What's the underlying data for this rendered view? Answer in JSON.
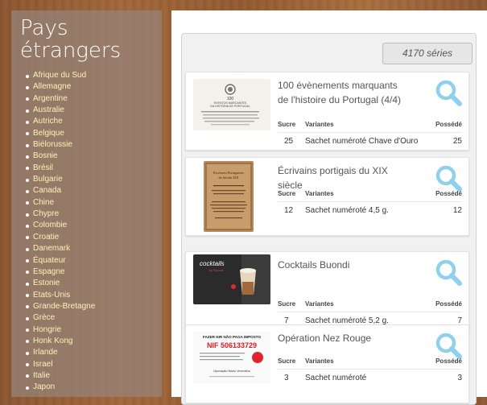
{
  "sidebar": {
    "title_line1": "Pays",
    "title_line2": "étrangers",
    "countries": [
      "Afrique du Sud",
      "Allemagne",
      "Argentine",
      "Australie",
      "Autriche",
      "Belgique",
      "Biélorussie",
      "Bosnie",
      "Brésil",
      "Bulgarie",
      "Canada",
      "Chine",
      "Chypre",
      "Colombie",
      "Croatie",
      "Danemark",
      "Équateur",
      "Espagne",
      "Estonie",
      "Etats-Unis",
      "Grande-Bretagne",
      "Grèce",
      "Hongrie",
      "Honk Kong",
      "Irlande",
      "Israel",
      "Italie",
      "Japon"
    ]
  },
  "main": {
    "series_count": "4170 séries",
    "columns": {
      "sucre": "Sucre",
      "variantes": "Variantes",
      "possede": "Possédé"
    },
    "cards": [
      {
        "title": "100 évènements marquants de l'histoire du Portugal (4/4)",
        "sucre": "25",
        "variante": "Sachet numéroté Chave d'Ouro",
        "possede": "25"
      },
      {
        "title": "Écrivains portigais du XIX siècle",
        "sucre": "12",
        "variante": "Sachet numéroté 4,5 g.",
        "possede": "12"
      },
      {
        "title": "Cocktails Buondi",
        "sucre": "7",
        "variante": "Sachet numéroté 5,2 g.",
        "possede": "7"
      },
      {
        "title": "Opération Nez Rouge",
        "sucre": "3",
        "variante": "Sachet numéroté",
        "possede": "3"
      }
    ]
  },
  "thumbs": {
    "t0_line1": "100",
    "t0_line2": "EVENTOS MARCANTES",
    "t0_line3": "DA HISTÓRIA DE PORTUGAL",
    "t1_line1": "Escritores Portugueses",
    "t1_line2": "do Século XIX",
    "t2_brand": "cocktails",
    "t2_sub": "by Buondi",
    "t3_line1": "FAZER NIR NÃO PAGA IMPOSTO",
    "t3_nif": "NIF 506133729",
    "t3_line3": "Operação Nariz Vermelho"
  },
  "colors": {
    "accent_link": "#fbf2b7",
    "search_icon": "#8fd0ec"
  }
}
